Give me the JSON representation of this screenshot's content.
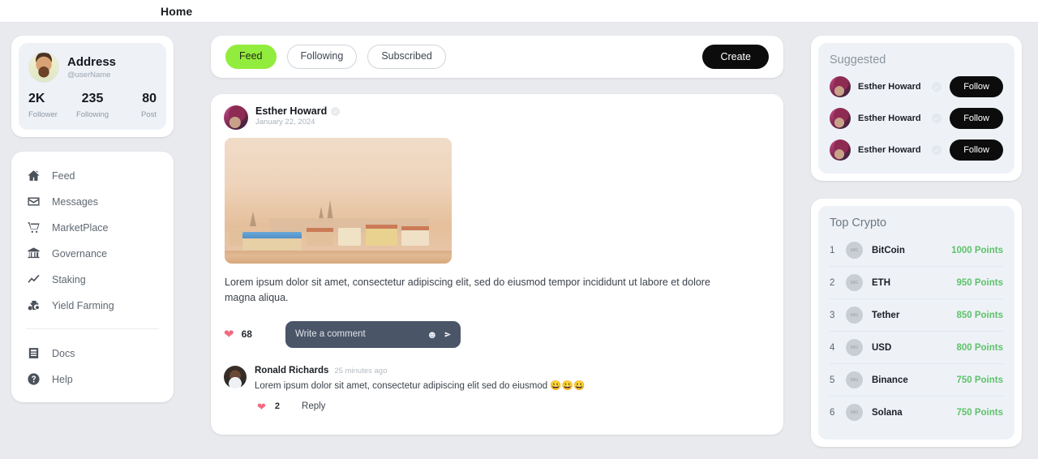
{
  "header": {
    "title": "Home"
  },
  "profile": {
    "name": "Address",
    "handle": "@userName",
    "stats": [
      {
        "value": "2K",
        "label": "Follower"
      },
      {
        "value": "235",
        "label": "Following"
      },
      {
        "value": "80",
        "label": "Post"
      }
    ]
  },
  "sidebar": {
    "items": [
      {
        "label": "Feed",
        "icon": "home-icon"
      },
      {
        "label": "Messages",
        "icon": "envelope-icon"
      },
      {
        "label": "MarketPlace",
        "icon": "cart-icon"
      },
      {
        "label": "Governance",
        "icon": "bank-icon"
      },
      {
        "label": "Staking",
        "icon": "chart-line-icon"
      },
      {
        "label": "Yield Farming",
        "icon": "tractor-icon"
      }
    ],
    "footer_items": [
      {
        "label": "Docs",
        "icon": "document-icon"
      },
      {
        "label": "Help",
        "icon": "question-circle-icon"
      }
    ]
  },
  "feed": {
    "tabs": [
      {
        "label": "Feed",
        "active": true
      },
      {
        "label": "Following",
        "active": false
      },
      {
        "label": "Subscribed",
        "active": false
      }
    ],
    "create_label": "Create",
    "accent_green": "#92ec3d",
    "post": {
      "author": "Esther Howard",
      "date": "January 22, 2024",
      "image_alt": "cityscape-photo",
      "text": "Lorem ipsum dolor sit amet, consectetur adipiscing elit, sed do eiusmod tempor incididunt ut labore et dolore magna aliqua.",
      "like_count": "68",
      "comment_placeholder": "Write a comment",
      "comment": {
        "author": "Ronald Richards",
        "time": "25 minutes ago",
        "text": "Lorem ipsum dolor sit amet, consectetur adipiscing elit sed do eiusmod 😀😀😀",
        "like_count": "2",
        "reply_label": "Reply"
      }
    }
  },
  "suggested": {
    "title": "Suggested",
    "items": [
      {
        "name": "Esther Howard",
        "action": "Follow"
      },
      {
        "name": "Esther Howard",
        "action": "Follow"
      },
      {
        "name": "Esther Howard",
        "action": "Follow"
      }
    ]
  },
  "top_crypto": {
    "title": "Top Crypto",
    "items": [
      {
        "rank": "1",
        "name": "BitCoin",
        "points": "1000 Points"
      },
      {
        "rank": "2",
        "name": "ETH",
        "points": "950 Points"
      },
      {
        "rank": "3",
        "name": "Tether",
        "points": "850 Points"
      },
      {
        "rank": "4",
        "name": "USD",
        "points": "800 Points"
      },
      {
        "rank": "5",
        "name": "Binance",
        "points": "750 Points"
      },
      {
        "rank": "6",
        "name": "Solana",
        "points": "750 Points"
      }
    ],
    "points_color": "#5ec26a"
  }
}
